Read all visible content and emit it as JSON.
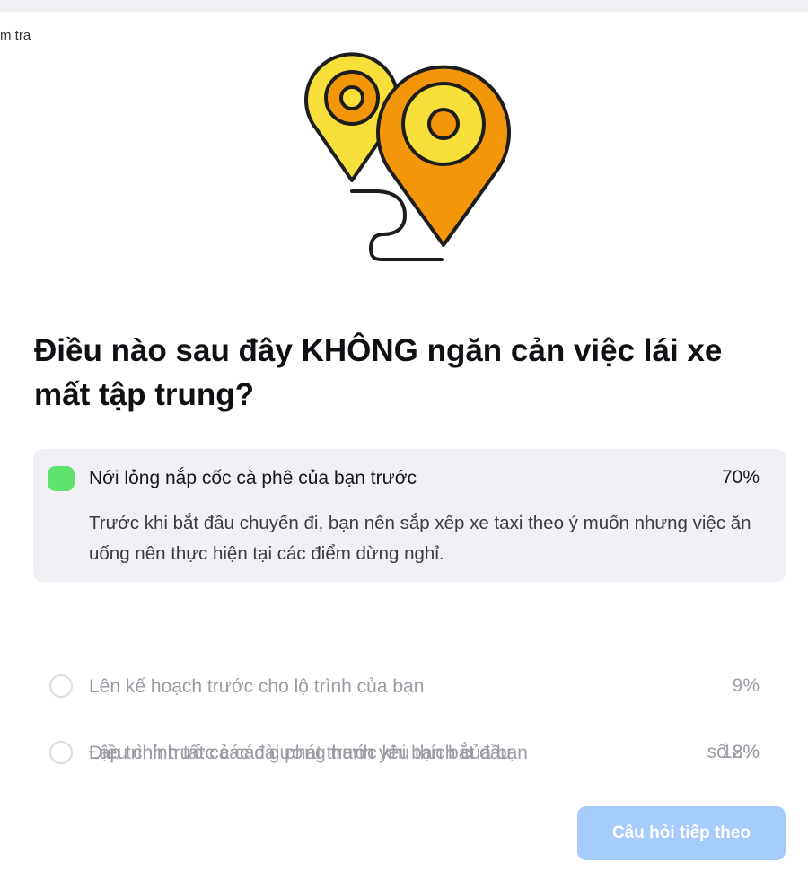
{
  "header": {
    "breadcrumb_partial": "m tra"
  },
  "illustration": {
    "icon": "map-pins-route-icon",
    "colors": {
      "yellow": "#f9df3a",
      "orange": "#f4960a",
      "outline": "#1d1d1d"
    }
  },
  "question": {
    "text": "Điều nào sau đây KHÔNG ngăn cản việc lái xe mất tập trung?"
  },
  "options": [
    {
      "label": "Nới lỏng nắp cốc cà phê của bạn trước",
      "percent": "70%",
      "selected": true,
      "explanation": "Trước khi bắt đầu chuyến đi, bạn nên sắp xếp xe taxi theo ý muốn nhưng việc ăn uống nên thực hiện tại các điểm dừng nghỉ."
    },
    {
      "label": "Điều chỉnh tất cả các gương trước khi bạn bắt đầu",
      "percent": "12%",
      "selected": false
    },
    {
      "label": "Lên kế hoạch trước cho lộ trình của bạn",
      "percent": "9%",
      "selected": false
    },
    {
      "label": "Lập trình trước các đài phát thanh yêu thích của bạn",
      "percent": "số 8%",
      "selected": false
    }
  ],
  "next_button": {
    "label": "Câu hỏi tiếp theo"
  },
  "colors": {
    "selected_indicator": "#5fe26e",
    "button_bg": "#a5ccfb",
    "selected_bg": "#f0f0f5"
  }
}
